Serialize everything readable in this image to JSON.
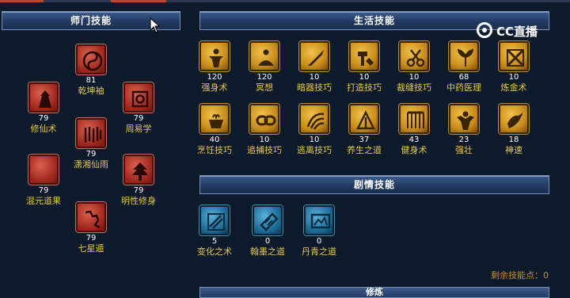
{
  "sections": {
    "shimen": "师门技能",
    "life": "生活技能",
    "story": "剧情技能",
    "bottom": "修炼"
  },
  "watermark": {
    "text": "CC直播"
  },
  "shimen_skills": [
    {
      "name": "乾坤袖",
      "level": "81",
      "icon": "yin-yang-icon"
    },
    {
      "name": "修仙术",
      "level": "79",
      "icon": "immortal-icon"
    },
    {
      "name": "周易学",
      "level": "79",
      "icon": "scroll-icon"
    },
    {
      "name": "潇湘仙雨",
      "level": "79",
      "icon": "rain-icon"
    },
    {
      "name": "混元道果",
      "level": "79",
      "icon": "moon-orb-icon"
    },
    {
      "name": "明性修身",
      "level": "79",
      "icon": "tree-icon"
    },
    {
      "name": "七星遁",
      "level": "79",
      "icon": "seven-stars-icon"
    }
  ],
  "life_skills": [
    {
      "name": "强身术",
      "level": "120",
      "icon": "body-icon"
    },
    {
      "name": "冥想",
      "level": "120",
      "icon": "meditate-icon"
    },
    {
      "name": "暗器技巧",
      "level": "10",
      "icon": "dart-icon"
    },
    {
      "name": "打造技巧",
      "level": "10",
      "icon": "hammer-icon"
    },
    {
      "name": "裁缝技巧",
      "level": "10",
      "icon": "scissors-icon"
    },
    {
      "name": "中药医理",
      "level": "68",
      "icon": "herb-icon"
    },
    {
      "name": "炼金术",
      "level": "10",
      "icon": "alchemy-icon"
    },
    {
      "name": "烹饪技巧",
      "level": "40",
      "icon": "pot-icon"
    },
    {
      "name": "追捕技巧",
      "level": "10",
      "icon": "chain-icon"
    },
    {
      "name": "逃离技巧",
      "level": "10",
      "icon": "escape-icon"
    },
    {
      "name": "养生之道",
      "level": "37",
      "icon": "health-icon"
    },
    {
      "name": "健身术",
      "level": "43",
      "icon": "fitness-icon"
    },
    {
      "name": "强壮",
      "level": "23",
      "icon": "muscle-icon"
    },
    {
      "name": "神速",
      "level": "18",
      "icon": "speed-icon"
    }
  ],
  "story_skills": [
    {
      "name": "变化之术",
      "level": "5",
      "icon": "transform-icon"
    },
    {
      "name": "翰墨之道",
      "level": "0",
      "icon": "ink-icon"
    },
    {
      "name": "丹青之道",
      "level": "0",
      "icon": "painting-icon"
    }
  ],
  "remaining": {
    "label": "剩余技能点：",
    "value": "0"
  }
}
